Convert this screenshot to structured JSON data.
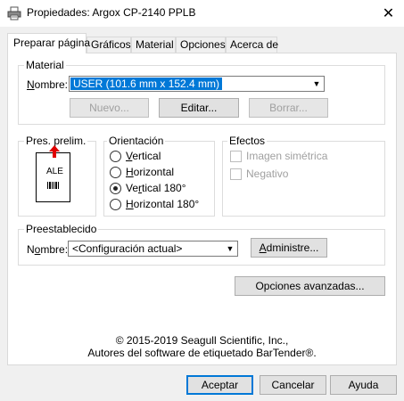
{
  "window": {
    "title": "Propiedades: Argox CP-2140 PPLB",
    "close": "✕"
  },
  "tabs": [
    {
      "label": "Preparar página",
      "active": true
    },
    {
      "label": "Gráficos"
    },
    {
      "label": "Material"
    },
    {
      "label": "Opciones"
    },
    {
      "label": "Acerca de"
    }
  ],
  "material": {
    "group_label": "Material",
    "name_label": "Nombre:",
    "selected": "USER (101.6 mm x 152.4 mm)",
    "new_button": "Nuevo...",
    "edit_button": "Editar...",
    "delete_button": "Borrar..."
  },
  "preview": {
    "group_label": "Pres. prelim.",
    "paper_text": "ALE"
  },
  "orientation": {
    "group_label": "Orientación",
    "options": [
      {
        "label": "Vertical",
        "selected": false
      },
      {
        "label": "Horizontal",
        "selected": false
      },
      {
        "label": "Vertical 180°",
        "selected": true
      },
      {
        "label": "Horizontal 180°",
        "selected": false
      }
    ]
  },
  "effects": {
    "group_label": "Efectos",
    "options": [
      {
        "label": "Imagen simétrica",
        "checked": false
      },
      {
        "label": "Negativo",
        "checked": false
      }
    ]
  },
  "preset": {
    "group_label": "Preestablecido",
    "name_label": "Nombre:",
    "selected": "<Configuración actual>",
    "manage_button": "Administre..."
  },
  "advanced_button": "Opciones avanzadas...",
  "copyright": {
    "line1": "© 2015-2019 Seagull Scientific, Inc.,",
    "line2": "Autores del software de etiquetado BarTender®."
  },
  "footer": {
    "accept": "Aceptar",
    "cancel": "Cancelar",
    "help": "Ayuda"
  },
  "colors": {
    "accent": "#0078d7",
    "arrow": "#e00000"
  }
}
